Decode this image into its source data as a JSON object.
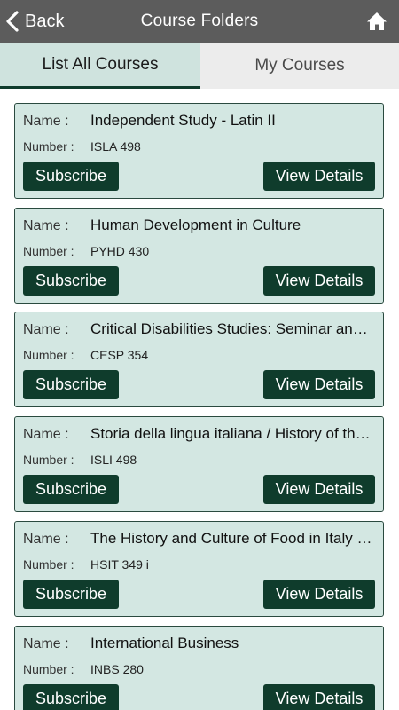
{
  "header": {
    "back_label": "Back",
    "title": "Course Folders"
  },
  "tabs": {
    "all": "List All Courses",
    "mine": "My Courses"
  },
  "labels": {
    "name": "Name :",
    "number": "Number :",
    "subscribe": "Subscribe",
    "view": "View Details"
  },
  "courses": [
    {
      "name": "Independent Study - Latin II",
      "number": "ISLA 498"
    },
    {
      "name": "Human Development in Culture",
      "number": "PYHD 430"
    },
    {
      "name": "Critical Disabilities Studies: Seminar and…",
      "number": "CESP 354"
    },
    {
      "name": "Storia della lingua italiana / History of th…",
      "number": "ISLI 498"
    },
    {
      "name": "The History and Culture of Food in Italy (…",
      "number": "HSIT 349 i"
    },
    {
      "name": "International Business",
      "number": "INBS 280"
    }
  ],
  "colors": {
    "topbar": "#5c5c5c",
    "accent": "#0f3c2c",
    "card_bg": "#d3e7e2",
    "active_tab": "#cfe3de",
    "inactive_tab": "#ececec"
  },
  "icons": {
    "back": "chevron-left-icon",
    "home": "home-icon"
  }
}
